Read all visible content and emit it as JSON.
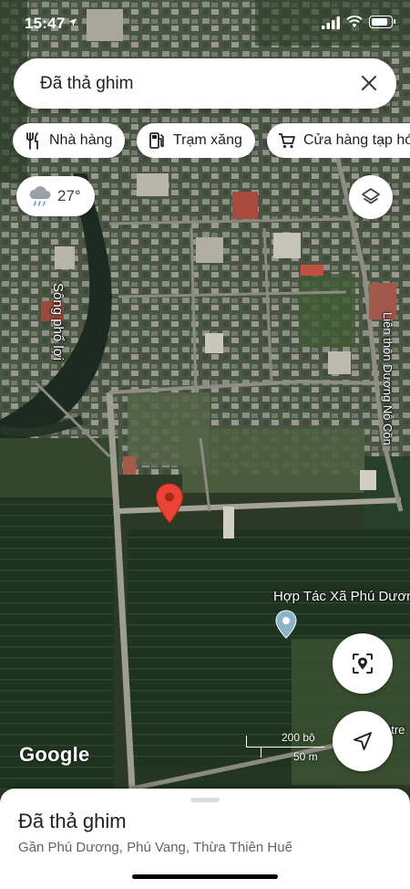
{
  "status_bar": {
    "time": "15:47",
    "battery_level": 0.85
  },
  "search": {
    "query": "Đã thả ghim",
    "close_icon": "close-icon"
  },
  "chips": [
    {
      "icon": "restaurant-icon",
      "label": "Nhà hàng"
    },
    {
      "icon": "gas-station-icon",
      "label": "Trạm xăng"
    },
    {
      "icon": "shopping-cart-icon",
      "label": "Cửa hàng tạp hóa"
    }
  ],
  "weather": {
    "icon": "rain-cloud-icon",
    "temperature": "27°"
  },
  "map_labels": {
    "river": "Sông phổ lợi",
    "road": "Liên thôn Dương Nỗ Cồn",
    "poi": "Hợp Tác Xã Phú Dươn",
    "entrance": "ntre"
  },
  "scale": {
    "feet": "200 bộ",
    "meters": "50 m"
  },
  "attribution": "Google",
  "place": {
    "title": "Đã thả ghim",
    "address": "Gần Phú Dương, Phú Vang, Thừa Thiên Huế"
  },
  "colors": {
    "pin_red": "#ea4335",
    "poi_blue": "#8ab4c8",
    "accent": "#1a73e8"
  }
}
